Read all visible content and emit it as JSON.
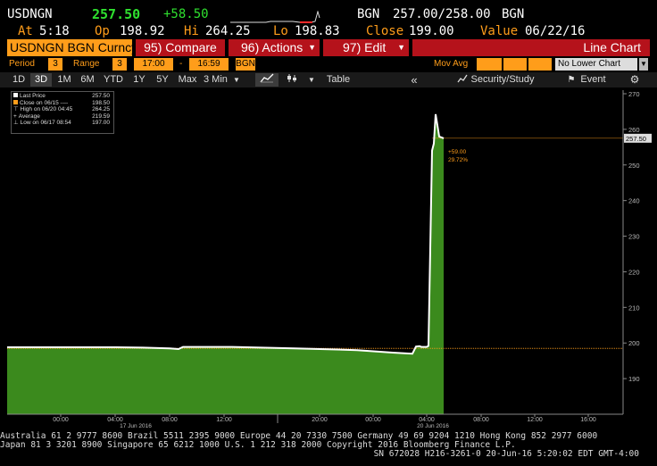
{
  "header": {
    "ticker": "USDNGN",
    "last": "257.50",
    "change": "+58.50",
    "source": "BGN",
    "bid_ask": "257.00/258.00",
    "source2": "BGN",
    "at_label": "At",
    "at_time": "5:18",
    "open_label": "Op",
    "open": "198.92",
    "high_label": "Hi",
    "high": "264.25",
    "low_label": "Lo",
    "low": "198.83",
    "close_label": "Close",
    "close": "199.00",
    "value_label": "Value",
    "value_date": "06/22/16"
  },
  "menu": {
    "security": "USDNGN BGN Curncy",
    "compare": "95) Compare",
    "actions": "96) Actions",
    "edit": "97) Edit",
    "chart_type": "Line Chart"
  },
  "settings": {
    "period_label": "Period",
    "period": "3",
    "range_label": "Range",
    "range": "3",
    "from": "17:00",
    "dash": "-",
    "to": "16:59",
    "pricing": "BGN",
    "mov_avg_label": "Mov Avg",
    "lower_chart": "No Lower Chart"
  },
  "toolbar": {
    "periods": [
      "1D",
      "3D",
      "1M",
      "6M",
      "YTD",
      "1Y",
      "5Y",
      "Max"
    ],
    "selected_period": "3D",
    "interval": "3 Min",
    "table": "Table",
    "security_study": "Security/Study",
    "event": "Event"
  },
  "legend": [
    {
      "label": "Last Price",
      "value": "257.50",
      "color": "#ffffff"
    },
    {
      "label": "Close on 06/15 ----",
      "value": "198.50",
      "color": "#ff9d1a"
    },
    {
      "label": "High on 06/20 04:45",
      "value": "264.25",
      "color": "#dddddd"
    },
    {
      "label": "Average",
      "value": "219.59",
      "color": "#dddddd"
    },
    {
      "label": "Low on 06/17 08:54",
      "value": "197.00",
      "color": "#dddddd"
    }
  ],
  "annotation": {
    "change": "+59.00",
    "pct": "29.72%"
  },
  "last_tag": "257.50",
  "chart_data": {
    "type": "area",
    "title": "",
    "x": [
      "15 Jun 16:00",
      "16 Jun 00:00",
      "16 Jun 04:00",
      "16 Jun 08:00",
      "16 Jun 09:30",
      "16 Jun 12:00",
      "16 Jun 20:00",
      "17 Jun 00:00",
      "17 Jun 04:00",
      "17 Jun 08:00",
      "17 Jun 08:54",
      "17 Jun 09:30",
      "17 Jun 12:00",
      "17 Jun 16:00",
      "20 Jun 00:00",
      "20 Jun 02:00",
      "20 Jun 03:30",
      "20 Jun 03:50",
      "20 Jun 04:10",
      "20 Jun 04:30",
      "20 Jun 04:45",
      "20 Jun 05:00",
      "20 Jun 05:18"
    ],
    "series": [
      {
        "values": [
          198.8,
          198.8,
          198.7,
          198.5,
          198.3,
          198.9,
          198.9,
          198.5,
          198.0,
          197.3,
          197.0,
          199.0,
          199.1,
          198.9,
          198.9,
          198.9,
          198.9,
          199.2,
          254.0,
          256.0,
          264.25,
          258.0,
          257.5
        ]
      }
    ],
    "ylim": [
      180,
      271
    ],
    "y_ticks": [
      190,
      200,
      210,
      220,
      230,
      240,
      250,
      260,
      270
    ],
    "x_ticks": [
      "00:00",
      "04:00",
      "08:00",
      "12:00",
      "20:00",
      "00:00",
      "04:00",
      "08:00",
      "12:00",
      "16:00"
    ],
    "date_labels": [
      "17 Jun 2016",
      "20 Jun 2016"
    ],
    "reference_close": 198.5,
    "grid": false
  },
  "footer": {
    "line1": "Australia 61 2 9777 8600 Brazil 5511 2395 9000 Europe 44 20 7330 7500 Germany 49 69 9204 1210 Hong Kong 852 2977 6000",
    "line2": "Japan 81 3 3201 8900        Singapore 65 6212 1000        U.S. 1 212 318 2000           Copyright 2016 Bloomberg Finance L.P.",
    "line3": "SN 672028 H216-3261-0 20-Jun-16  5:20:02 EDT  GMT-4:00"
  }
}
